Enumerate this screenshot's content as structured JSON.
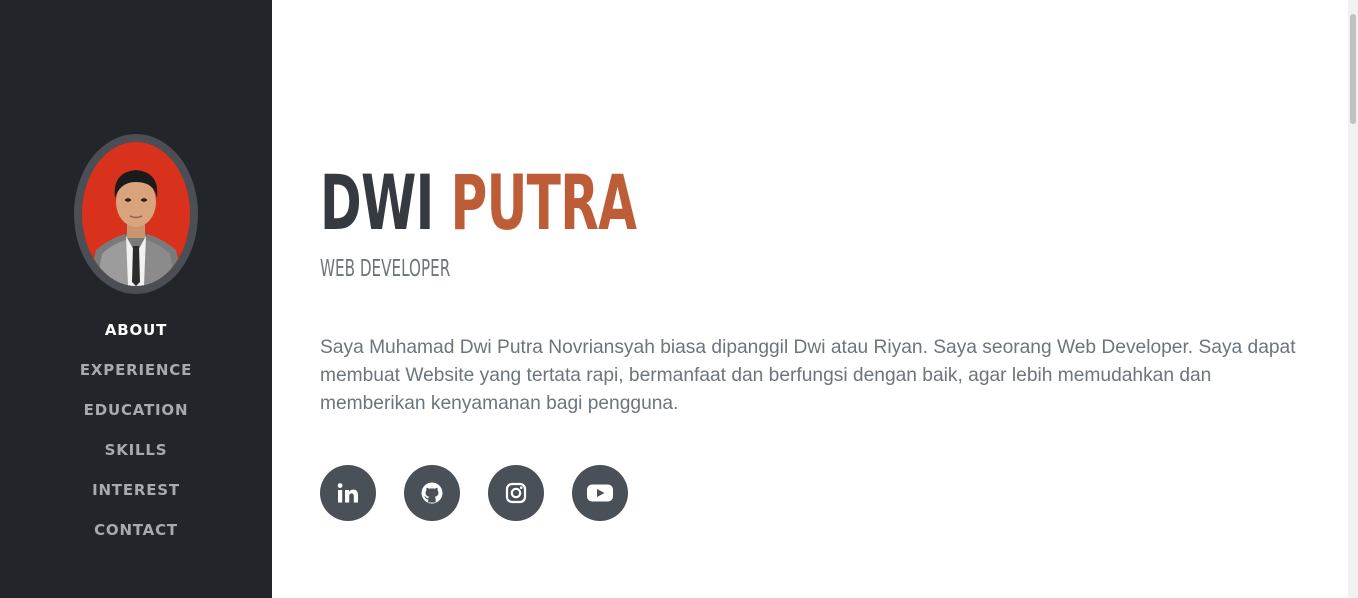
{
  "profile": {
    "first_name": "DWI",
    "last_name": "PUTRA",
    "role": "WEB DEVELOPER",
    "bio": "Saya Muhamad Dwi Putra Novriansyah biasa dipanggil Dwi atau Riyan. Saya seorang Web Developer. Saya dapat membuat Website yang tertata rapi, bermanfaat dan berfungsi dengan baik, agar lebih memudahkan dan memberikan kenyamanan bagi pengguna."
  },
  "sidebar": {
    "items": [
      {
        "label": "ABOUT",
        "active": true
      },
      {
        "label": "EXPERIENCE",
        "active": false
      },
      {
        "label": "EDUCATION",
        "active": false
      },
      {
        "label": "SKILLS",
        "active": false
      },
      {
        "label": "INTEREST",
        "active": false
      },
      {
        "label": "CONTACT",
        "active": false
      }
    ]
  },
  "socials": [
    {
      "icon": "linkedin-icon"
    },
    {
      "icon": "github-icon"
    },
    {
      "icon": "instagram-icon"
    },
    {
      "icon": "youtube-icon"
    }
  ],
  "colors": {
    "sidebar_bg": "#22252a",
    "accent": "#bd5d38",
    "heading": "#343a40",
    "muted_text": "#6c757d",
    "social_bg": "#495057"
  }
}
